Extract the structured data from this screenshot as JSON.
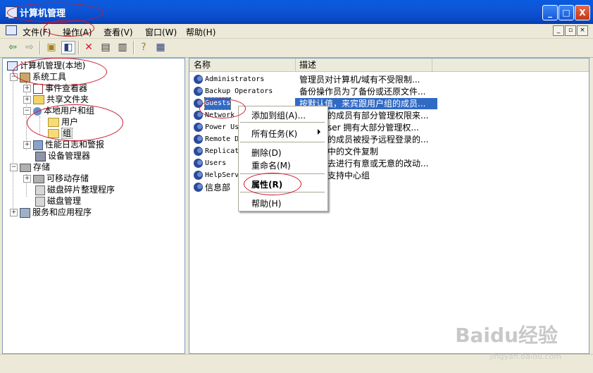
{
  "window": {
    "title": "计算机管理",
    "min": "_",
    "max": "□",
    "close": "X"
  },
  "menu": {
    "items": [
      "文件(F)",
      "操作(A)",
      "查看(V)",
      "窗口(W)",
      "帮助(H)"
    ],
    "mdi": [
      "_",
      "▫",
      "×"
    ]
  },
  "toolbar": {
    "buttons": [
      "back-icon",
      "forward-icon",
      "up-folder-icon",
      "show-hide-tree-icon",
      "delete-icon",
      "properties-icon",
      "export-icon",
      "help-icon",
      "console-icon"
    ]
  },
  "tree": {
    "root": "计算机管理(本地)",
    "system_tools": "系统工具",
    "event_viewer": "事件查看器",
    "shared_folders": "共享文件夹",
    "local_users": "本地用户和组",
    "users": "用户",
    "groups": "组",
    "perf_logs": "性能日志和警报",
    "device_manager": "设备管理器",
    "storage": "存储",
    "removable": "可移动存储",
    "defrag": "磁盘碎片整理程序",
    "disk_mgmt": "磁盘管理",
    "services": "服务和应用程序"
  },
  "list": {
    "headers": [
      "名称",
      "描述"
    ],
    "rows": [
      {
        "name": "Administrators",
        "desc": "管理员对计算机/域有不受限制..."
      },
      {
        "name": "Backup Operators",
        "desc": "备份操作员为了备份或还原文件..."
      },
      {
        "name": "Guests",
        "desc": "按默认值，来宾跟用户组的成员..."
      },
      {
        "name": "Network",
        "desc": "的成员有部分管理权限来..."
      },
      {
        "name": "Power Us",
        "desc": "ser 拥有大部分管理权..."
      },
      {
        "name": "Remote D",
        "desc": "的成员被授予远程登录的..."
      },
      {
        "name": "Replicat",
        "desc": "中的文件复制"
      },
      {
        "name": "Users",
        "desc": "去进行有意或无意的改动..."
      },
      {
        "name": "HelpServ",
        "desc": "支持中心组"
      },
      {
        "name": "信息部",
        "desc": ""
      }
    ]
  },
  "context_menu": {
    "add_to_group": "添加到组(A)...",
    "all_tasks": "所有任务(K)",
    "delete": "删除(D)",
    "rename": "重命名(M)",
    "properties": "属性(R)",
    "help": "帮助(H)"
  },
  "watermark": {
    "brand": "Baidu经验",
    "url": "jingyan.baidu.com"
  },
  "colors": {
    "titlebar": "#0a5be0",
    "selection": "#316ac5",
    "annotation": "#d0192f"
  }
}
